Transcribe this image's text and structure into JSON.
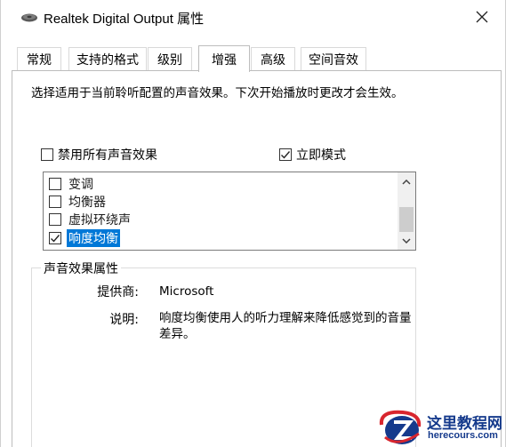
{
  "window": {
    "title": "Realtek Digital Output 属性",
    "close_symbol": "✕",
    "title_icon": "speaker-icon"
  },
  "tabs": [
    {
      "label": "常规",
      "active": false
    },
    {
      "label": "支持的格式",
      "active": false
    },
    {
      "label": "级别",
      "active": false
    },
    {
      "label": "增强",
      "active": true
    },
    {
      "label": "高级",
      "active": false
    },
    {
      "label": "空间音效",
      "active": false
    }
  ],
  "enhancements": {
    "description": "选择适用于当前聆听配置的声音效果。下次开始播放时更改才会生效。",
    "disable_all": {
      "label": "禁用所有声音效果",
      "checked": false
    },
    "immediate_mode": {
      "label": "立即模式",
      "checked": true
    },
    "effects": [
      {
        "label": "变调",
        "checked": false,
        "selected": false
      },
      {
        "label": "均衡器",
        "checked": false,
        "selected": false
      },
      {
        "label": "虚拟环绕声",
        "checked": false,
        "selected": false
      },
      {
        "label": "响度均衡",
        "checked": true,
        "selected": true
      }
    ],
    "properties": {
      "group_title": "声音效果属性",
      "provider_label": "提供商:",
      "provider_value": "Microsoft",
      "description_label": "说明:",
      "description_value": "响度均衡使用人的听力理解来降低感觉到的音量差异。"
    }
  },
  "watermark": {
    "title": "这里教程网",
    "url": "herecours.com"
  },
  "colors": {
    "selection": "#0078d7",
    "watermark_blue": "#153a8c",
    "watermark_red": "#d8262e"
  }
}
